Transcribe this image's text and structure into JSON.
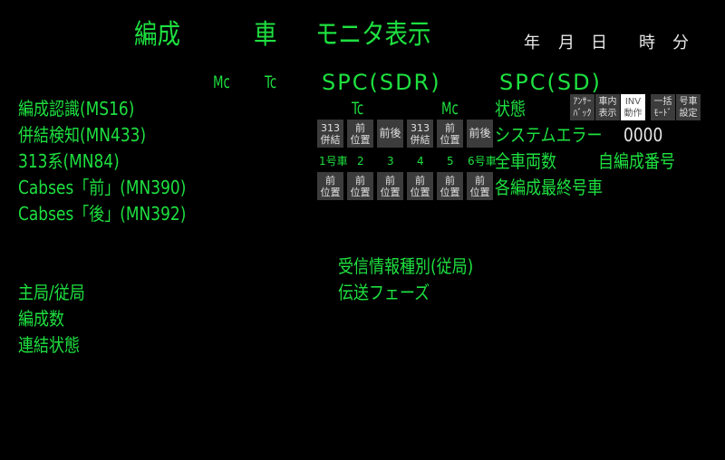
{
  "title": {
    "part1": "編成",
    "part2": "車",
    "part3": "モニタ表示"
  },
  "datetime": {
    "year": "年",
    "month": "月",
    "day": "日",
    "hour": "時",
    "minute": "分"
  },
  "header": {
    "mc": "Mc",
    "tc": "Tc",
    "spc_sdr": "SPC(SDR)",
    "spc_sd": "SPC(SD)"
  },
  "left_labels": [
    "編成認識(MS16)",
    "併結検知(MN433)",
    "313系(MN84)",
    "Cabses「前」(MN390)",
    "Cabses「後」(MN392)"
  ],
  "lower_labels": [
    "主局/従局",
    "編成数",
    "連結状態"
  ],
  "center_labels": {
    "rx_type": "受信情報種別(従局)",
    "phase": "伝送フェーズ"
  },
  "car_labels": {
    "tc": "Tc",
    "mc": "Mc"
  },
  "row1_buttons": [
    [
      "313",
      "併結"
    ],
    [
      "前",
      "位置"
    ],
    [
      "前後"
    ],
    [
      "313",
      "併結"
    ],
    [
      "前",
      "位置"
    ],
    [
      "前後"
    ]
  ],
  "car_numbers": [
    "1号車",
    "2",
    "3",
    "4",
    "5",
    "6号車"
  ],
  "row2_buttons": [
    [
      "前",
      "位置"
    ],
    [
      "前",
      "位置"
    ],
    [
      "前",
      "位置"
    ],
    [
      "前",
      "位置"
    ],
    [
      "前",
      "位置"
    ],
    [
      "前",
      "位置"
    ]
  ],
  "top_buttons": [
    [
      "ｱﾝｻｰ",
      "ﾊﾞｯｸ"
    ],
    [
      "車内",
      "表示"
    ],
    [
      "INV",
      "動作"
    ],
    [
      "一括",
      "ﾓｰﾄﾞ"
    ],
    [
      "号車",
      "設定"
    ]
  ],
  "status": {
    "state": "状態",
    "system_error": "システムエラー",
    "system_error_value": "0000",
    "total_cars": "全車両数",
    "own_formation_no": "自編成番号",
    "last_car": "各編成最終号車"
  }
}
